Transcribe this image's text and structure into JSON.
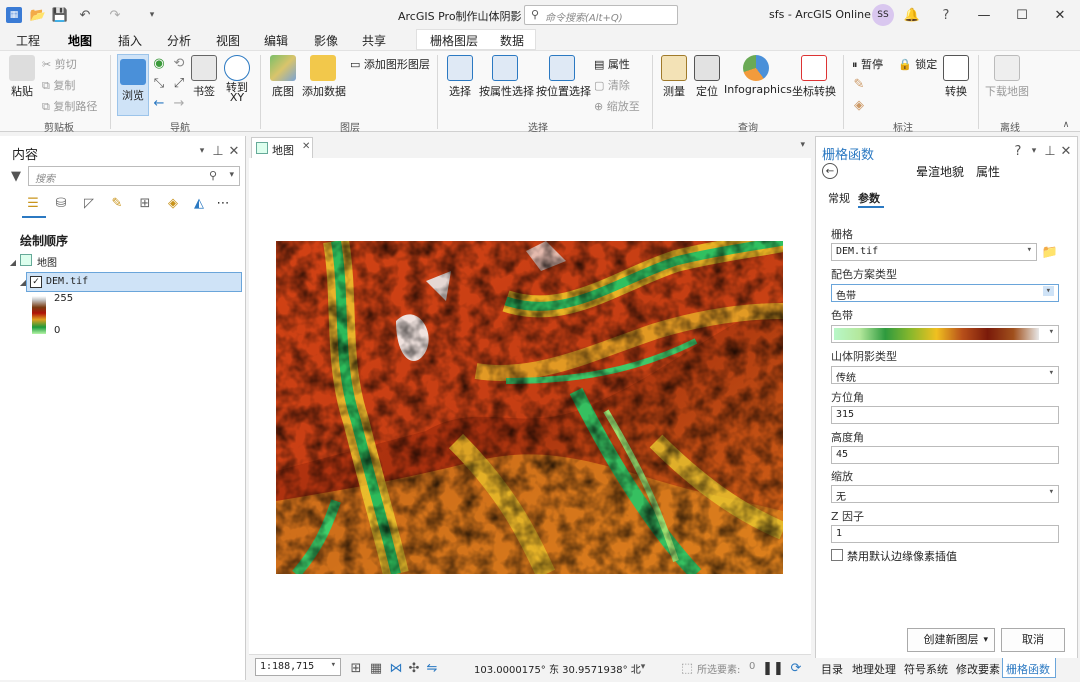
{
  "titlebar": {
    "title": "ArcGIS Pro制作山体阴影",
    "search_placeholder": "命令搜索(Alt+Q)",
    "account": "sfs - ArcGIS Online",
    "avatar": "SS"
  },
  "tabs": [
    "工程",
    "地图",
    "插入",
    "分析",
    "视图",
    "编辑",
    "影像",
    "共享"
  ],
  "context_tabs": [
    "栅格图层",
    "数据"
  ],
  "ribbon": {
    "clipboard": {
      "paste": "粘贴",
      "cut": "剪切",
      "copy": "复制",
      "copy_path": "复制路径",
      "group": "剪贴板"
    },
    "navigate": {
      "explore": "浏览",
      "bookmarks": "书签",
      "goto": "转到\nXY",
      "group": "导航"
    },
    "layer": {
      "basemap": "底图",
      "add_data": "添加数据",
      "add_graphics": "添加图形图层",
      "group": "图层"
    },
    "selection": {
      "select": "选择",
      "by_attr": "按属性选择",
      "by_loc": "按位置选择",
      "attributes": "属性",
      "clear": "清除",
      "zoom": "缩放至",
      "group": "选择"
    },
    "inquiry": {
      "measure": "测量",
      "locate": "定位",
      "infographics": "Infographics",
      "coord": "坐标转换",
      "group": "查询"
    },
    "labeling": {
      "pause": "暂停",
      "lock": "锁定",
      "convert": "转换",
      "group": "标注"
    },
    "offline": {
      "download": "下载地图",
      "group": "离线"
    }
  },
  "contents": {
    "title": "内容",
    "search_placeholder": "搜索",
    "drawing_order": "绘制顺序",
    "map_name": "地图",
    "layer_name": "DEM.tif",
    "legend_high": "255",
    "legend_low": "0"
  },
  "map_tab": "地图",
  "status": {
    "scale": "1:188,715",
    "coords": "103.0000175° 东  30.9571938° 北",
    "selected_label": "所选要素:",
    "selected_count": "0"
  },
  "panel": {
    "title": "栅格函数",
    "subtitle": "晕渲地貌",
    "props": "属性",
    "tab_general": "常规",
    "tab_params": "参数",
    "raster_label": "栅格",
    "raster_value": "DEM.tif",
    "scheme_label": "配色方案类型",
    "scheme_value": "色带",
    "ramp_label": "色带",
    "hillshade_label": "山体阴影类型",
    "hillshade_value": "传统",
    "azimuth_label": "方位角",
    "azimuth_value": "315",
    "altitude_label": "高度角",
    "altitude_value": "45",
    "scaling_label": "缩放",
    "scaling_value": "无",
    "zfactor_label": "Z 因子",
    "zfactor_value": "1",
    "checkbox_label": "禁用默认边缘像素插值",
    "create_btn": "创建新图层",
    "cancel_btn": "取消"
  },
  "bottom_tabs": [
    "目录",
    "地理处理",
    "符号系统",
    "修改要素",
    "栅格函数"
  ]
}
